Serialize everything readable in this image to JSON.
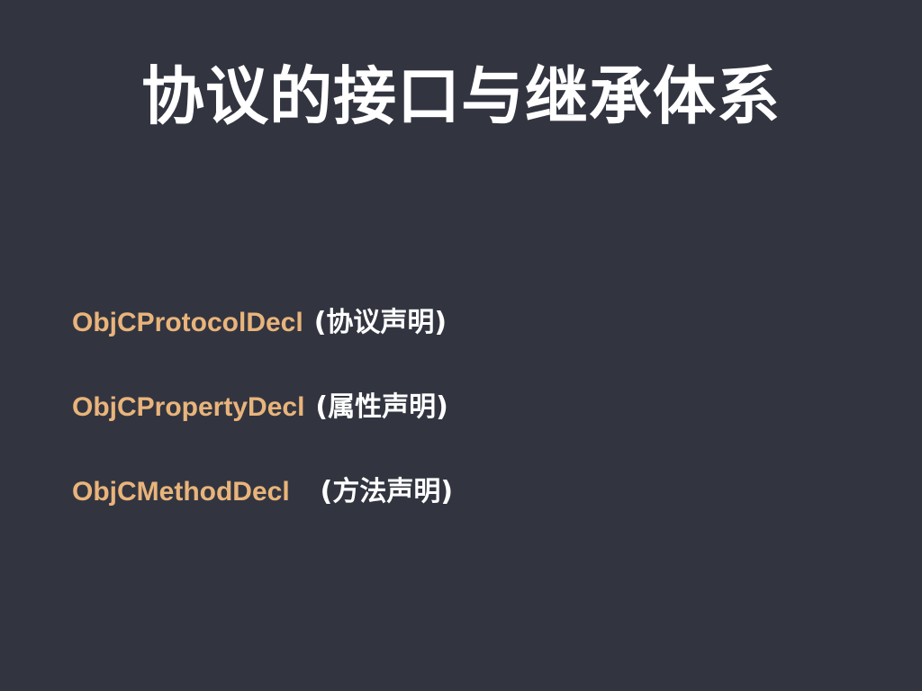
{
  "slide": {
    "title": "协议的接口与继承体系",
    "items": [
      {
        "decl": "ObjCProtocolDecl",
        "desc": "(协议声明)"
      },
      {
        "decl": "ObjCPropertyDecl",
        "desc": "(属性声明)"
      },
      {
        "decl": "ObjCMethodDecl",
        "desc": "(方法声明)"
      }
    ],
    "colors": {
      "background": "#323540",
      "title": "#ffffff",
      "decl": "#e9b47b",
      "desc": "#ffffff"
    }
  }
}
